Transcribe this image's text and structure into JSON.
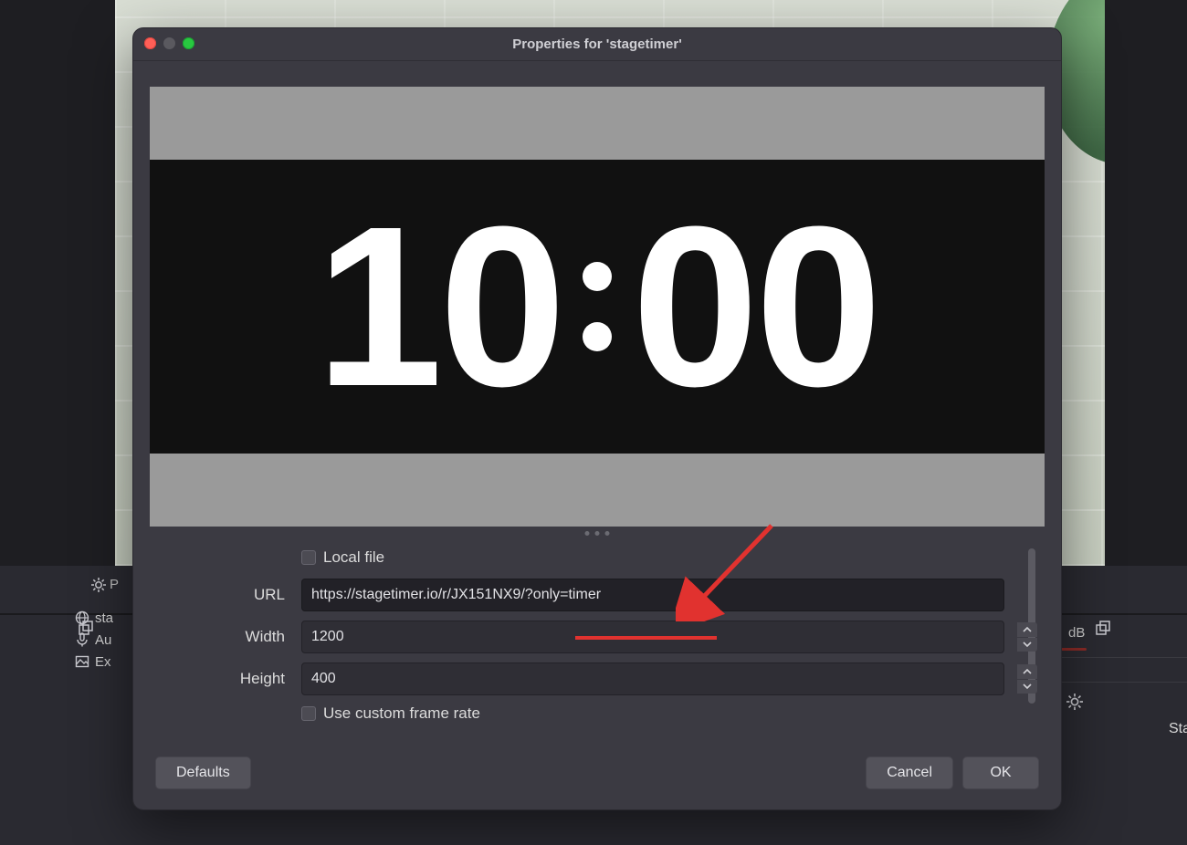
{
  "dialog": {
    "title": "Properties for 'stagetimer'",
    "timer_display": "10:00",
    "local_file_label": "Local file",
    "url_label": "URL",
    "url_value": "https://stagetimer.io/r/JX151NX9/?only=timer",
    "width_label": "Width",
    "width_value": "1200",
    "height_label": "Height",
    "height_value": "400",
    "custom_fr_label": "Use custom frame rate",
    "defaults_label": "Defaults",
    "cancel_label": "Cancel",
    "ok_label": "OK"
  },
  "left_panel": {
    "p_label": "P",
    "items": [
      "sta",
      "Au",
      "Ex"
    ]
  },
  "right_panel": {
    "db_label": "dB",
    "sta_label": "Sta"
  }
}
